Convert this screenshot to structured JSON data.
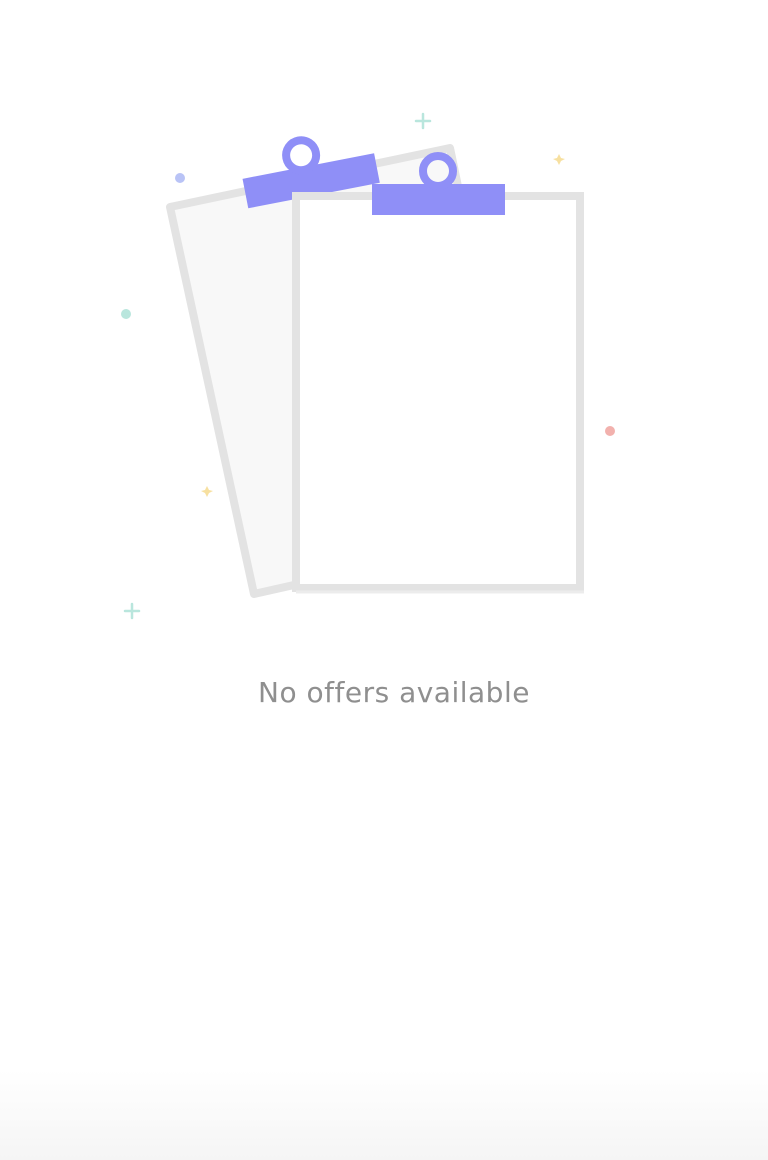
{
  "empty_state": {
    "message": "No offers available"
  },
  "colors": {
    "clip": "#8f8ff7",
    "sheet_border": "#e3e3e3",
    "sheet_back_fill": "#f8f8f8",
    "sheet_front_fill": "#ffffff",
    "text": "#8f8f8f",
    "dot_blue": "#b9c3f6",
    "dot_green": "#b9e6dd",
    "dot_red": "#f2b1ad",
    "star_yellow": "#f7e0a0",
    "plus_green": "#b9e6dd"
  },
  "icons": {
    "illustration": "empty-clipboards-icon"
  }
}
